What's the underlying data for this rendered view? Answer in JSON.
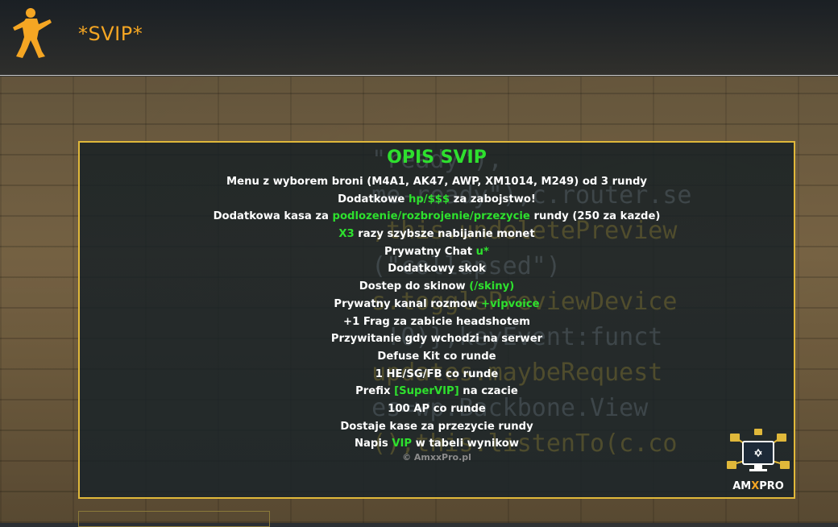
{
  "header": {
    "title": "*SVIP*",
    "logo_icon": "counter-strike-soldier-icon"
  },
  "panel": {
    "heading": "OPIS SVIP",
    "rows": [
      {
        "a": "Menu z wyborem broni (M4A1, AK47, AWP, XM1014, M249) od 3 rundy",
        "h": "",
        "b": ""
      },
      {
        "a": "Dodatkowe ",
        "h": "hp/$$$",
        "b": " za zabojstwo!"
      },
      {
        "a": "Dodatkowa kasa za ",
        "h": "podlozenie/rozbrojenie/przezycie",
        "b": " rundy (250 za kazde)"
      },
      {
        "a": "",
        "h": "X3",
        "b": " razy szybsze nabijanie monet"
      },
      {
        "a": "Prywatny Chat ",
        "h": "u*",
        "b": ""
      },
      {
        "a": "Dodatkowy skok",
        "h": "",
        "b": ""
      },
      {
        "a": "Dostep do skinow ",
        "h": "(/skiny)",
        "b": ""
      },
      {
        "a": "Prywatny kanal rozmow ",
        "h": "+vipvoice",
        "b": ""
      },
      {
        "a": "+1 Frag za zabicie headshotem",
        "h": "",
        "b": ""
      },
      {
        "a": "Przywitanie gdy wchodzi na serwer",
        "h": "",
        "b": ""
      },
      {
        "a": "Defuse Kit co runde",
        "h": "",
        "b": ""
      },
      {
        "a": "1 HE/SG/FB co runde",
        "h": "",
        "b": ""
      },
      {
        "a": "Prefix ",
        "h": "[SuperVIP]",
        "b": " na czacie"
      },
      {
        "a": "100 AP co runde",
        "h": "",
        "b": ""
      },
      {
        "a": "Dostaje kase za przezycie rundy",
        "h": "",
        "b": ""
      },
      {
        "a": "Napis ",
        "h": "VIP",
        "b": " w tabeli wynikow"
      }
    ],
    "copyright": "© AmxxPro.pl"
  },
  "badge": {
    "text_a": "AM",
    "text_x": "X",
    "text_b": "PRO",
    "icon": "computer-network-icon"
  },
  "colors": {
    "accent_orange": "#f5a623",
    "highlight_green": "#2ee02e",
    "panel_border": "#e0b83a"
  }
}
